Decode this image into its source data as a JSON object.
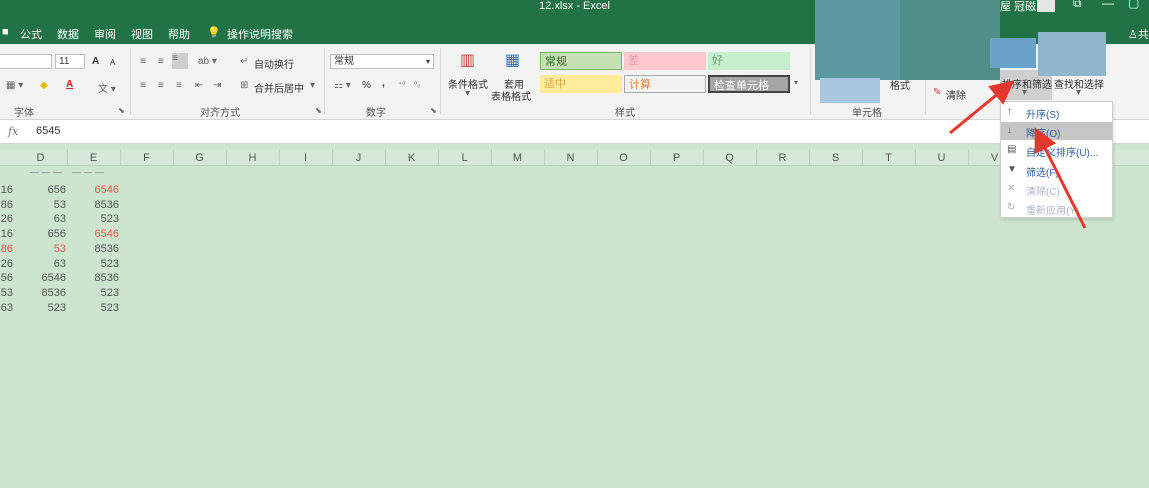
{
  "window": {
    "title": "12.xlsx  -  Excel",
    "user_name": "屋 冠磁",
    "minimize": "—",
    "restore": "▢",
    "ribbon_display": "⧉"
  },
  "tabs": [
    "公式",
    "数据",
    "审阅",
    "视图",
    "帮助"
  ],
  "tell_me": "操作说明搜索",
  "share_label": "共",
  "ribbon": {
    "font_size": "11",
    "grow_font": "A",
    "shrink_font": "A",
    "font_color_letter": "A",
    "wrap_text": "自动换行",
    "merge_center": "合并后居中",
    "number_format": "常规",
    "percent": "%",
    "comma": ",",
    "conditional_format": "条件格式",
    "format_as_table_1": "套用",
    "format_as_table_2": "表格格式",
    "styles": {
      "normal": "常规",
      "bad": "差",
      "good": "好",
      "neutral": "适中",
      "calculation": "计算",
      "check_cell": "检查单元格"
    },
    "format_label": "格式",
    "clear_label": "清除",
    "sort_filter": "排序和筛选",
    "find_select": "查找和选择",
    "groups": {
      "font": "字体",
      "alignment": "对齐方式",
      "number": "数字",
      "styles": "样式",
      "cells": "单元格"
    }
  },
  "formula_bar": {
    "fx": "fx",
    "value": "6545"
  },
  "columns": [
    "D",
    "E",
    "F",
    "G",
    "H",
    "I",
    "J",
    "K",
    "L",
    "M",
    "N",
    "O",
    "P",
    "Q",
    "R",
    "S",
    "T",
    "U",
    "V"
  ],
  "rows": [
    {
      "c": "16",
      "d": "656",
      "e": "6546",
      "c_red": false,
      "d_red": false,
      "e_red": true
    },
    {
      "c": "86",
      "d": "53",
      "e": "8536",
      "c_red": false,
      "d_red": false,
      "e_red": false
    },
    {
      "c": "26",
      "d": "63",
      "e": "523",
      "c_red": false,
      "d_red": false,
      "e_red": false
    },
    {
      "c": "16",
      "d": "656",
      "e": "6546",
      "c_red": false,
      "d_red": false,
      "e_red": true
    },
    {
      "c": "86",
      "d": "53",
      "e": "8536",
      "c_red": true,
      "d_red": true,
      "e_red": false
    },
    {
      "c": "26",
      "d": "63",
      "e": "523",
      "c_red": false,
      "d_red": false,
      "e_red": false
    },
    {
      "c": "56",
      "d": "6546",
      "e": "8536",
      "c_red": false,
      "d_red": false,
      "e_red": false
    },
    {
      "c": "53",
      "d": "8536",
      "e": "523",
      "c_red": false,
      "d_red": false,
      "e_red": false
    },
    {
      "c": "63",
      "d": "523",
      "e": "523",
      "c_red": false,
      "d_red": false,
      "e_red": false
    }
  ],
  "sort_menu": [
    {
      "icon": "sort-ascending-icon",
      "glyph": "↑",
      "label": "升序(S)",
      "disabled": false,
      "highlight": false
    },
    {
      "icon": "sort-descending-icon",
      "glyph": "↓",
      "label": "降序(O)",
      "disabled": false,
      "highlight": true
    },
    {
      "icon": "custom-sort-icon",
      "glyph": "▤",
      "label": "自定义排序(U)...",
      "disabled": false,
      "highlight": false
    },
    {
      "icon": "filter-icon",
      "glyph": "▼",
      "label": "筛选(F)",
      "disabled": false,
      "highlight": false
    },
    {
      "icon": "clear-filter-icon",
      "glyph": "✕",
      "label": "清除(C)",
      "disabled": true,
      "highlight": false
    },
    {
      "icon": "reapply-icon",
      "glyph": "↻",
      "label": "重新应用(Y)",
      "disabled": true,
      "highlight": false
    }
  ],
  "colors": {
    "excel_green": "#217346",
    "arrow_red": "#e8372c",
    "style_normal_bg": "#c6e0b4",
    "style_bad_bg": "#ffc7ce",
    "style_good_bg": "#c6efce",
    "style_neutral_bg": "#ffeb9c",
    "style_check_bg": "#a5a5a5"
  }
}
